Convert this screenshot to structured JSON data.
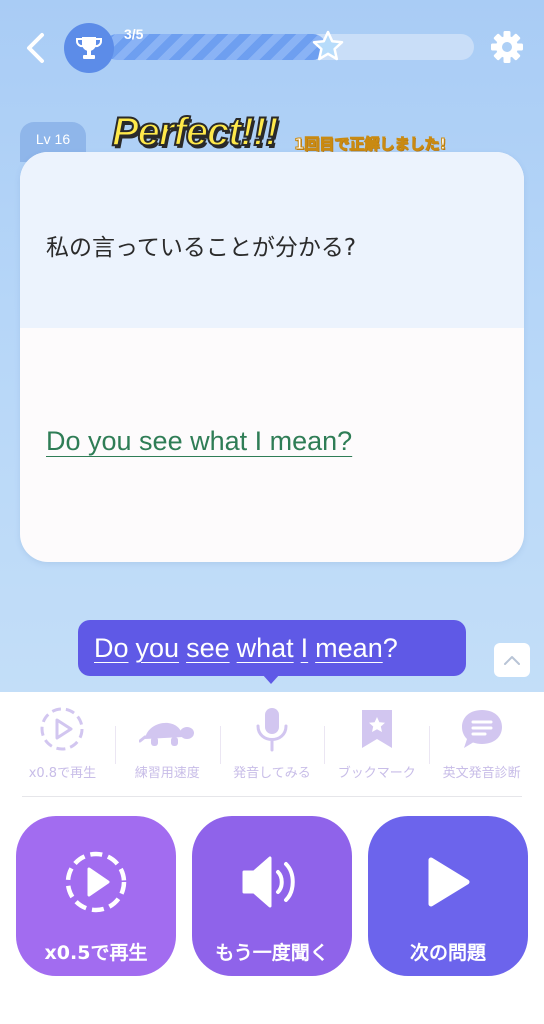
{
  "header": {
    "progress_text": "3/5",
    "progress_fraction": 0.6,
    "icons": [
      "chevron-left-icon",
      "trophy-icon",
      "star-icon",
      "gear-icon"
    ]
  },
  "card": {
    "level": "Lv 16",
    "japanese": "私の言っていることが分かる?",
    "english": "Do you see what I mean?"
  },
  "feedback": {
    "title": "Perfect!!!",
    "subtitle": "1回目で正解しました!"
  },
  "bubble": {
    "words": [
      "Do",
      "you",
      "see",
      "what",
      "I",
      "mean"
    ],
    "punct": "?"
  },
  "toolbar": {
    "items": [
      {
        "label": "x0.8で再生",
        "icon": "replay-slow-icon"
      },
      {
        "label": "練習用速度",
        "icon": "turtle-icon"
      },
      {
        "label": "発音してみる",
        "icon": "microphone-icon"
      },
      {
        "label": "ブックマーク",
        "icon": "bookmark-icon"
      },
      {
        "label": "英文発音診断",
        "icon": "diagnosis-icon"
      }
    ]
  },
  "actions": {
    "slow": "x0.5で再生",
    "replay": "もう一度聞く",
    "next": "次の問題"
  },
  "colors": {
    "accent_purple": "#a26cf0",
    "accent_violet": "#8f63ea",
    "accent_indigo": "#6c64ec",
    "answer_green": "#2f7d56",
    "bubble": "#5f59e6"
  }
}
